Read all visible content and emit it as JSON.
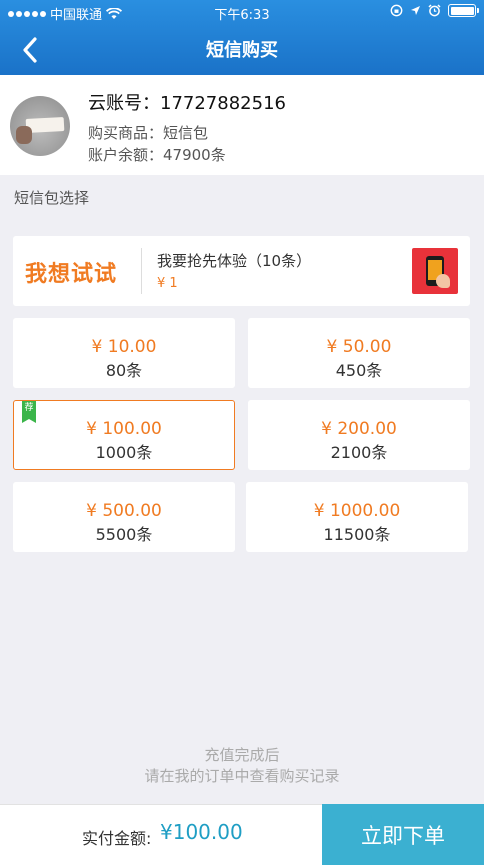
{
  "status_bar": {
    "carrier": "中国联通",
    "time": "下午6:33"
  },
  "nav": {
    "title": "短信购买",
    "back_icon": "chevron-left-icon"
  },
  "account": {
    "label_account": "云账号：17727882516",
    "label_product": "购买商品：短信包",
    "label_balance": "账户余额：47900条"
  },
  "section_title": "短信包选择",
  "trial": {
    "logo_text": "我想试试",
    "title": "我要抢先体验（10条）",
    "price": "¥ 1"
  },
  "packages": [
    {
      "price": "¥ 10.00",
      "count": "80条"
    },
    {
      "price": "¥ 50.00",
      "count": "450条"
    },
    {
      "price": "¥ 100.00",
      "count": "1000条",
      "badge": "荐",
      "selected": true
    },
    {
      "price": "¥ 200.00",
      "count": "2100条"
    },
    {
      "price": "¥ 500.00",
      "count": "5500条"
    },
    {
      "price": "¥ 1000.00",
      "count": "11500条"
    }
  ],
  "tip": {
    "line1": "充值完成后",
    "line2": "请在我的订单中查看购买记录"
  },
  "bottom": {
    "pay_label": "实付金额:",
    "pay_amount": "¥100.00",
    "order_button": "立即下单"
  },
  "colors": {
    "header": "#1a72c8",
    "accent": "#f07b22",
    "order_button": "#3bb0d1",
    "amount": "#1f9ec4",
    "badge": "#3bb54a"
  }
}
